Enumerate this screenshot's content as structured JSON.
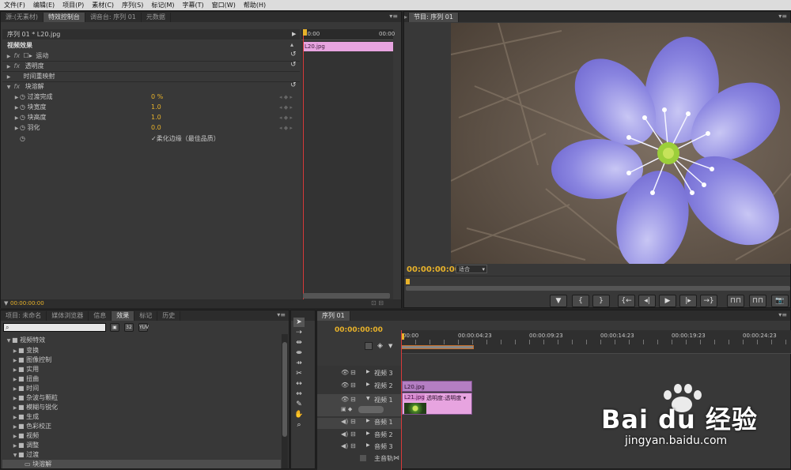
{
  "menu": [
    "文件(F)",
    "编辑(E)",
    "项目(P)",
    "素材(C)",
    "序列(S)",
    "标记(M)",
    "字幕(T)",
    "窗口(W)",
    "帮助(H)"
  ],
  "effect_controls": {
    "tabs": [
      {
        "label": "源:(无素材)"
      },
      {
        "label": "特效控制台"
      },
      {
        "label": "调音台: 序列 01"
      },
      {
        "label": "元数据"
      }
    ],
    "clip_label": "序列 01 * L20.jpg",
    "section": "视频效果",
    "effects": [
      {
        "name": "运动",
        "prefix": "☐▸"
      },
      {
        "name": "透明度",
        "prefix": ""
      },
      {
        "name": "时间重映射",
        "prefix": ""
      },
      {
        "name": "块溶解",
        "prefix": ""
      }
    ],
    "params": [
      {
        "name": "过渡完成",
        "value": "0 %"
      },
      {
        "name": "块宽度",
        "value": "1.0"
      },
      {
        "name": "块高度",
        "value": "1.0"
      },
      {
        "name": "羽化",
        "value": "0.0"
      }
    ],
    "checkbox_label": "柔化边缘（最佳品质）",
    "time_ruler_start": "00:00",
    "time_ruler_end": "00:00",
    "clip_bar": "L20.jpg",
    "timecode": "00:00:00:00"
  },
  "program": {
    "tab": "节目: 序列 01",
    "timecode": "00:00:00:00",
    "fit": "适合",
    "controls": [
      "▼",
      "{",
      "}",
      "{←",
      "◂|",
      "▶",
      "|▸",
      "→}",
      "⊓⊓",
      "⊓⊓",
      "📷"
    ]
  },
  "effects_panel": {
    "tabs": [
      {
        "label": "项目: 未命名"
      },
      {
        "label": "媒体浏览器"
      },
      {
        "label": "信息"
      },
      {
        "label": "效果"
      },
      {
        "label": "标记"
      },
      {
        "label": "历史"
      }
    ],
    "root": "视频特效",
    "folders": [
      "变换",
      "图像控制",
      "实用",
      "扭曲",
      "时间",
      "杂波与颗粒",
      "模糊与锐化",
      "生成",
      "色彩校正",
      "视频",
      "调整",
      "过渡"
    ],
    "leaf": "块溶解"
  },
  "timeline": {
    "tab": "序列 01",
    "timecode": "00:00:00:00",
    "ruler": [
      "00:00",
      "00:00:04:23",
      "00:00:09:23",
      "00:00:14:23",
      "00:00:19:23",
      "00:00:24:23"
    ],
    "video_tracks": [
      "视频 3",
      "视频 2",
      "视频 1"
    ],
    "audio_tracks": [
      "音频 1",
      "音频 2",
      "音频 3"
    ],
    "master": "主音轨",
    "clip_v2": "L20.jpg",
    "clip_v1": "L21.jpg",
    "clip_v1_fx": "透明度:透明度 ▾"
  },
  "watermark": {
    "brand": "Bai du 经验",
    "url": "jingyan.baidu.com"
  },
  "colors": {
    "accent_yellow": "#e8b22a",
    "clip_pink": "#e7a4e0",
    "playhead_red": "#d83a3a"
  }
}
